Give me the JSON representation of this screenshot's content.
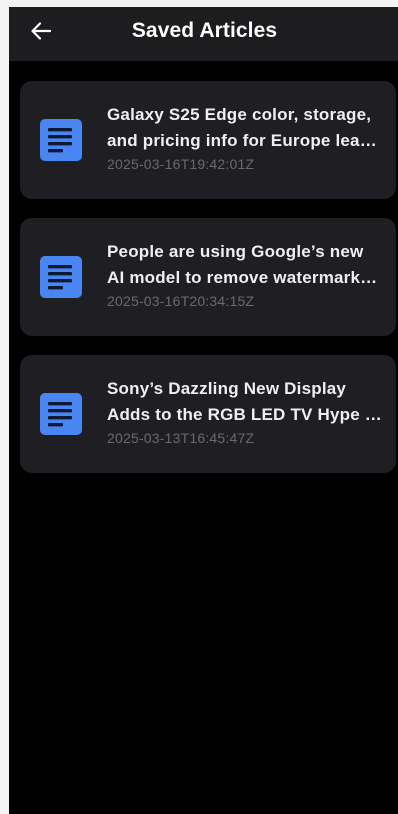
{
  "app_bar": {
    "title": "Saved Articles",
    "back_icon": "arrow-left-icon"
  },
  "articles": [
    {
      "title": "Galaxy S25 Edge color, storage, and pricing info for Europe lea…",
      "date": "2025-03-16T19:42:01Z",
      "icon": "document-icon"
    },
    {
      "title": "People are using Google’s new AI model to remove watermark…",
      "date": "2025-03-16T20:34:15Z",
      "icon": "document-icon"
    },
    {
      "title": "Sony’s Dazzling New Display Adds to the RGB LED TV Hype …",
      "date": "2025-03-13T16:45:47Z",
      "icon": "document-icon"
    }
  ],
  "colors": {
    "app_bar_bg": "#1d1d1f",
    "screen_bg": "#000000",
    "card_bg": "#1f1e22",
    "icon_accent": "#4a86f2",
    "title_text": "#efefef",
    "date_text": "#6a6a6e"
  }
}
